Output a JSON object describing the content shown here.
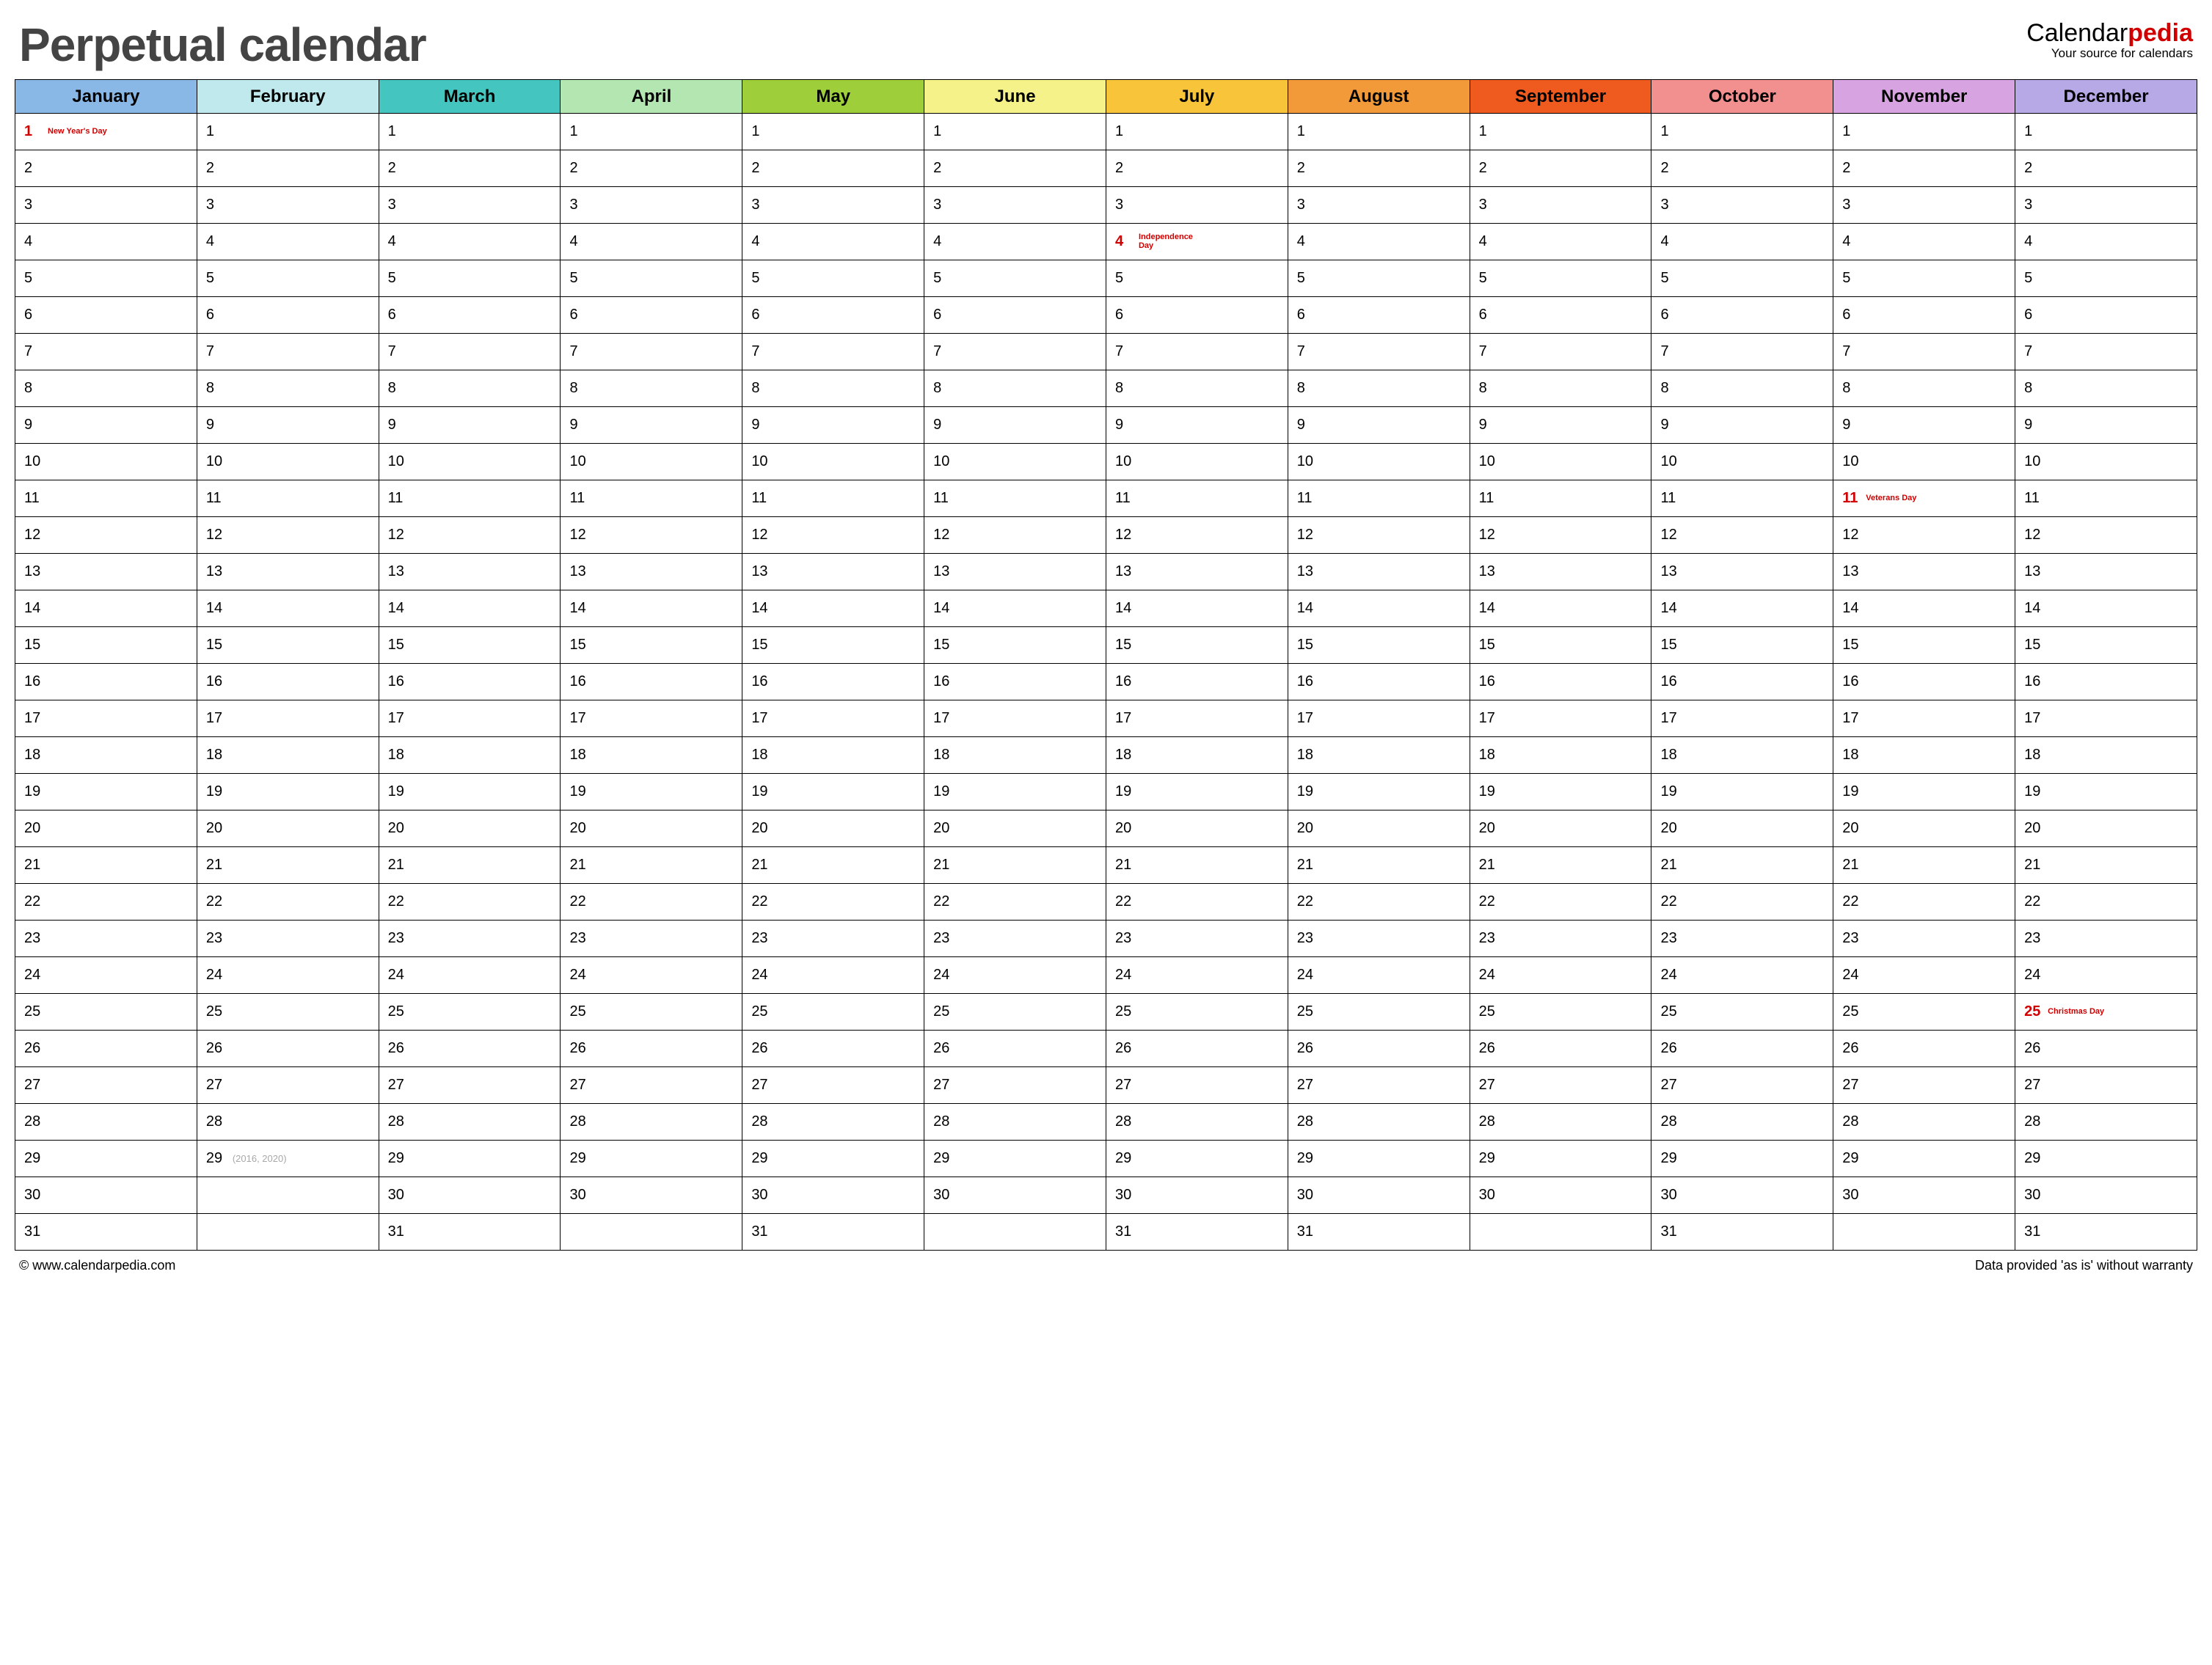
{
  "header": {
    "title": "Perpetual calendar",
    "brand_prefix": "Calendar",
    "brand_accent": "pedia",
    "brand_tagline": "Your source for calendars"
  },
  "months": [
    {
      "name": "January",
      "color": "#8ab8e6",
      "days": 31
    },
    {
      "name": "February",
      "color": "#bfe9ed",
      "days": 28
    },
    {
      "name": "March",
      "color": "#45c5bf",
      "days": 31
    },
    {
      "name": "April",
      "color": "#b3e6b0",
      "days": 30
    },
    {
      "name": "May",
      "color": "#9ecf3b",
      "days": 31
    },
    {
      "name": "June",
      "color": "#f5f28a",
      "days": 30
    },
    {
      "name": "July",
      "color": "#f8c53a",
      "days": 31
    },
    {
      "name": "August",
      "color": "#f29a3a",
      "days": 31
    },
    {
      "name": "September",
      "color": "#ef5a1f",
      "days": 30
    },
    {
      "name": "October",
      "color": "#f28f8f",
      "days": 31
    },
    {
      "name": "November",
      "color": "#d7a3e0",
      "days": 30
    },
    {
      "name": "December",
      "color": "#b6a9e6",
      "days": 31
    }
  ],
  "max_rows": 31,
  "holidays": [
    {
      "month": 0,
      "day": 1,
      "label": "New Year's Day"
    },
    {
      "month": 6,
      "day": 4,
      "label": "Independence Day"
    },
    {
      "month": 10,
      "day": 11,
      "label": "Veterans Day"
    },
    {
      "month": 11,
      "day": 25,
      "label": "Christmas Day"
    }
  ],
  "leap_note": {
    "month": 1,
    "day": 29,
    "text": "(2016, 2020)"
  },
  "footer": {
    "left": "© www.calendarpedia.com",
    "right": "Data provided 'as is' without warranty"
  }
}
